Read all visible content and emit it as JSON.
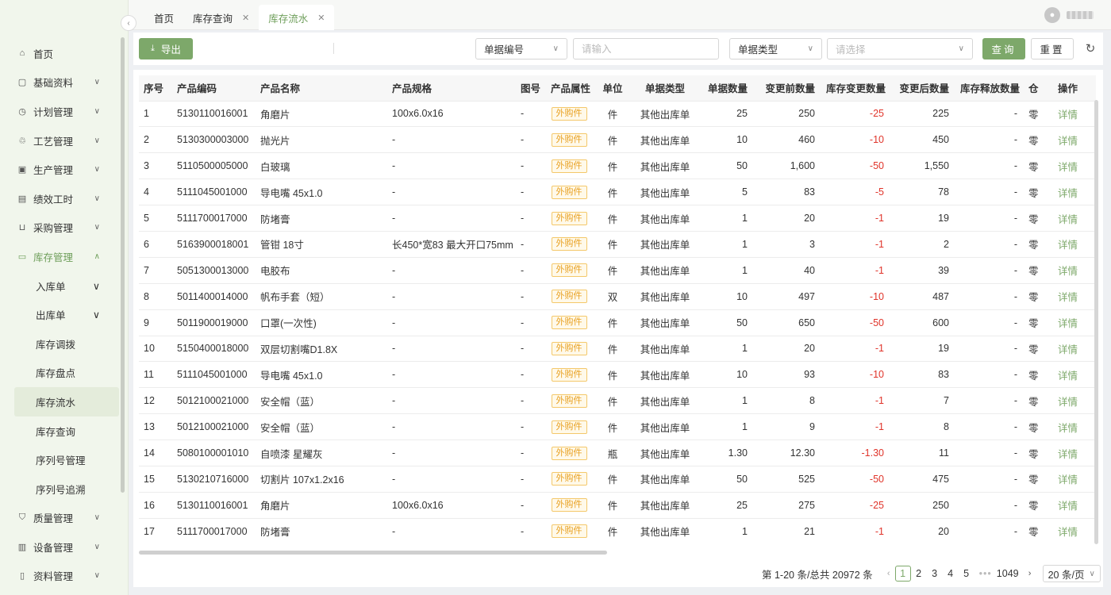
{
  "sidebar": {
    "collapse_icon": "chevron-left-icon",
    "items": [
      {
        "label": "首页",
        "icon": "⌂",
        "has_arrow": false
      },
      {
        "label": "基础资料",
        "icon": "▢",
        "has_arrow": true
      },
      {
        "label": "计划管理",
        "icon": "◷",
        "has_arrow": true
      },
      {
        "label": "工艺管理",
        "icon": "♲",
        "has_arrow": true
      },
      {
        "label": "生产管理",
        "icon": "▣",
        "has_arrow": true
      },
      {
        "label": "绩效工时",
        "icon": "▤",
        "has_arrow": true
      },
      {
        "label": "采购管理",
        "icon": "⊔",
        "has_arrow": true
      },
      {
        "label": "库存管理",
        "icon": "▭",
        "has_arrow": true,
        "open": true
      }
    ],
    "sub_items": [
      {
        "label": "入库单",
        "has_arrow": true
      },
      {
        "label": "出库单",
        "has_arrow": true
      },
      {
        "label": "库存调拨",
        "has_arrow": false
      },
      {
        "label": "库存盘点",
        "has_arrow": false
      },
      {
        "label": "库存流水",
        "has_arrow": false,
        "active": true
      },
      {
        "label": "库存查询",
        "has_arrow": false
      },
      {
        "label": "序列号管理",
        "has_arrow": false
      },
      {
        "label": "序列号追溯",
        "has_arrow": false
      }
    ],
    "bottom_items": [
      {
        "label": "质量管理",
        "icon": "⛉",
        "has_arrow": true
      },
      {
        "label": "设备管理",
        "icon": "▥",
        "has_arrow": true
      },
      {
        "label": "资料管理",
        "icon": "▯",
        "has_arrow": true
      }
    ]
  },
  "tabs": [
    {
      "label": "首页",
      "closable": false,
      "active": false
    },
    {
      "label": "库存查询",
      "closable": true,
      "active": false
    },
    {
      "label": "库存流水",
      "closable": true,
      "active": true
    }
  ],
  "toolbar": {
    "export_label": "导出",
    "doc_no_select": "单据编号",
    "doc_no_placeholder": "请输入",
    "doc_type_select": "单据类型",
    "doc_type_placeholder": "请选择",
    "query_label": "查询",
    "reset_label": "重置"
  },
  "table": {
    "columns": [
      "序号",
      "产品编码",
      "产品名称",
      "产品规格",
      "图号",
      "产品属性",
      "单位",
      "单据类型",
      "单据数量",
      "变更前数量",
      "库存变更数量",
      "变更后数量",
      "库存释放数量",
      "仓",
      "操作"
    ],
    "rows": [
      [
        "1",
        "5130110016001",
        "角磨片",
        "100x6.0x16",
        "-",
        "外购件",
        "件",
        "其他出库单",
        "25",
        "250",
        "-25",
        "225",
        "-",
        "零",
        "详情"
      ],
      [
        "2",
        "5130300003000",
        "抛光片",
        "-",
        "-",
        "外购件",
        "件",
        "其他出库单",
        "10",
        "460",
        "-10",
        "450",
        "-",
        "零",
        "详情"
      ],
      [
        "3",
        "5110500005000",
        "白玻璃",
        "-",
        "-",
        "外购件",
        "件",
        "其他出库单",
        "50",
        "1,600",
        "-50",
        "1,550",
        "-",
        "零",
        "详情"
      ],
      [
        "4",
        "5111045001000",
        "导电嘴 45x1.0",
        "-",
        "-",
        "外购件",
        "件",
        "其他出库单",
        "5",
        "83",
        "-5",
        "78",
        "-",
        "零",
        "详情"
      ],
      [
        "5",
        "5111700017000",
        "防堵膏",
        "-",
        "-",
        "外购件",
        "件",
        "其他出库单",
        "1",
        "20",
        "-1",
        "19",
        "-",
        "零",
        "详情"
      ],
      [
        "6",
        "5163900018001",
        "管钳 18寸",
        "长450*宽83 最大开口75mm",
        "-",
        "外购件",
        "件",
        "其他出库单",
        "1",
        "3",
        "-1",
        "2",
        "-",
        "零",
        "详情"
      ],
      [
        "7",
        "5051300013000",
        "电胶布",
        "-",
        "-",
        "外购件",
        "件",
        "其他出库单",
        "1",
        "40",
        "-1",
        "39",
        "-",
        "零",
        "详情"
      ],
      [
        "8",
        "5011400014000",
        "帆布手套（短）",
        "-",
        "-",
        "外购件",
        "双",
        "其他出库单",
        "10",
        "497",
        "-10",
        "487",
        "-",
        "零",
        "详情"
      ],
      [
        "9",
        "5011900019000",
        "口罩(一次性)",
        "-",
        "-",
        "外购件",
        "件",
        "其他出库单",
        "50",
        "650",
        "-50",
        "600",
        "-",
        "零",
        "详情"
      ],
      [
        "10",
        "5150400018000",
        "双层切割嘴D1.8X",
        "-",
        "-",
        "外购件",
        "件",
        "其他出库单",
        "1",
        "20",
        "-1",
        "19",
        "-",
        "零",
        "详情"
      ],
      [
        "11",
        "5111045001000",
        "导电嘴 45x1.0",
        "-",
        "-",
        "外购件",
        "件",
        "其他出库单",
        "10",
        "93",
        "-10",
        "83",
        "-",
        "零",
        "详情"
      ],
      [
        "12",
        "5012100021000",
        "安全帽（蓝）",
        "-",
        "-",
        "外购件",
        "件",
        "其他出库单",
        "1",
        "8",
        "-1",
        "7",
        "-",
        "零",
        "详情"
      ],
      [
        "13",
        "5012100021000",
        "安全帽（蓝）",
        "-",
        "-",
        "外购件",
        "件",
        "其他出库单",
        "1",
        "9",
        "-1",
        "8",
        "-",
        "零",
        "详情"
      ],
      [
        "14",
        "5080100001010",
        "自喷漆 星耀灰",
        "-",
        "-",
        "外购件",
        "瓶",
        "其他出库单",
        "1.30",
        "12.30",
        "-1.30",
        "11",
        "-",
        "零",
        "详情"
      ],
      [
        "15",
        "5130210716000",
        "切割片 107x1.2x16",
        "-",
        "-",
        "外购件",
        "件",
        "其他出库单",
        "50",
        "525",
        "-50",
        "475",
        "-",
        "零",
        "详情"
      ],
      [
        "16",
        "5130110016001",
        "角磨片",
        "100x6.0x16",
        "-",
        "外购件",
        "件",
        "其他出库单",
        "25",
        "275",
        "-25",
        "250",
        "-",
        "零",
        "详情"
      ],
      [
        "17",
        "5111700017000",
        "防堵膏",
        "-",
        "-",
        "外购件",
        "件",
        "其他出库单",
        "1",
        "21",
        "-1",
        "20",
        "-",
        "零",
        "详情"
      ]
    ]
  },
  "pagination": {
    "summary": "第 1-20 条/总共 20972 条",
    "pages": [
      "1",
      "2",
      "3",
      "4",
      "5"
    ],
    "ellipsis": "•••",
    "last_page": "1049",
    "page_size": "20 条/页"
  }
}
